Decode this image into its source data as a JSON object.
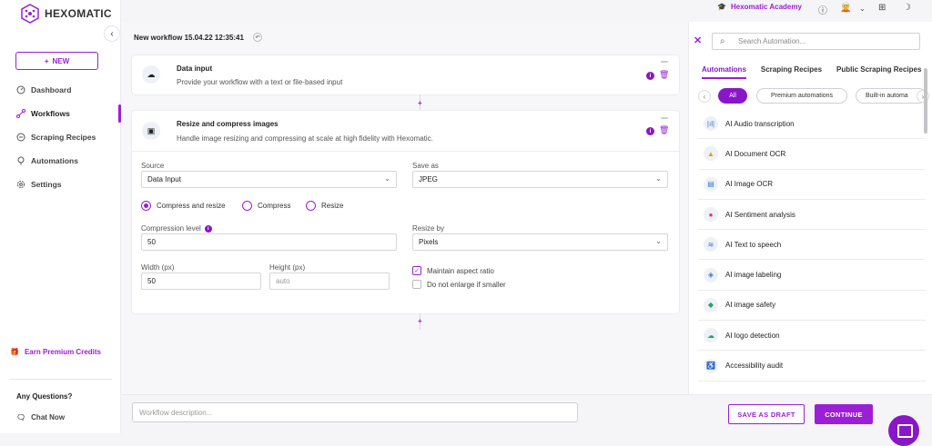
{
  "app": {
    "name": "HEXOMATIC"
  },
  "sidebar": {
    "new_label": "NEW",
    "items": [
      {
        "label": "Dashboard",
        "icon": "dashboard-icon"
      },
      {
        "label": "Workflows",
        "icon": "workflows-icon",
        "active": true
      },
      {
        "label": "Scraping Recipes",
        "icon": "recipes-icon"
      },
      {
        "label": "Automations",
        "icon": "automations-icon"
      },
      {
        "label": "Settings",
        "icon": "settings-icon"
      }
    ],
    "earn": "Earn Premium Credits",
    "questions": "Any Questions?",
    "chat": "Chat Now"
  },
  "topbar": {
    "academy": "Hexomatic Academy"
  },
  "workflow": {
    "title": "New workflow 15.04.22 12:35:41",
    "steps": [
      {
        "title": "Data input",
        "desc": "Provide your workflow with a text or file-based input"
      },
      {
        "title": "Resize and compress images",
        "desc": "Handle image resizing and compressing at scale at high fidelity with Hexomatic."
      }
    ],
    "form": {
      "source_label": "Source",
      "source_value": "Data Input",
      "saveas_label": "Save as",
      "saveas_value": "JPEG",
      "radios": [
        "Compress and resize",
        "Compress",
        "Resize"
      ],
      "selected_radio": 0,
      "compression_label": "Compression level",
      "compression_value": "50",
      "resizeby_label": "Resize by",
      "resizeby_value": "Pixels",
      "width_label": "Width (px)",
      "width_value": "50",
      "height_label": "Height (px)",
      "height_placeholder": "auto",
      "maintain_label": "Maintain aspect ratio",
      "maintain_checked": true,
      "noenlarge_label": "Do not enlarge if smaller",
      "noenlarge_checked": false
    }
  },
  "bottom": {
    "desc_placeholder": "Workflow description...",
    "draft": "SAVE AS DRAFT",
    "continue": "CONTINUE"
  },
  "panel": {
    "search_placeholder": "Search Automation...",
    "tabs": [
      "Automations",
      "Scraping Recipes",
      "Public Scraping Recipes"
    ],
    "chips": [
      "All",
      "Premium automations",
      "Built-in automa"
    ],
    "items": [
      {
        "label": "AI Audio transcription",
        "icon": "audio-icon",
        "glyph": "|ıl|"
      },
      {
        "label": "AI Document OCR",
        "icon": "document-ocr-icon",
        "glyph": "▲"
      },
      {
        "label": "AI Image OCR",
        "icon": "image-ocr-icon",
        "glyph": "▤"
      },
      {
        "label": "AI Sentiment analysis",
        "icon": "sentiment-icon",
        "glyph": "●"
      },
      {
        "label": "AI Text to speech",
        "icon": "text-to-speech-icon",
        "glyph": "≋"
      },
      {
        "label": "AI image labeling",
        "icon": "labeling-icon",
        "glyph": "◈"
      },
      {
        "label": "AI image safety",
        "icon": "image-safety-icon",
        "glyph": "◆"
      },
      {
        "label": "AI logo detection",
        "icon": "logo-detection-icon",
        "glyph": "☁"
      },
      {
        "label": "Accessibility audit",
        "icon": "accessibility-icon",
        "glyph": "♿"
      }
    ]
  },
  "colors": {
    "accent": "#9b1fd6",
    "accent_dark": "#8a16c9"
  }
}
